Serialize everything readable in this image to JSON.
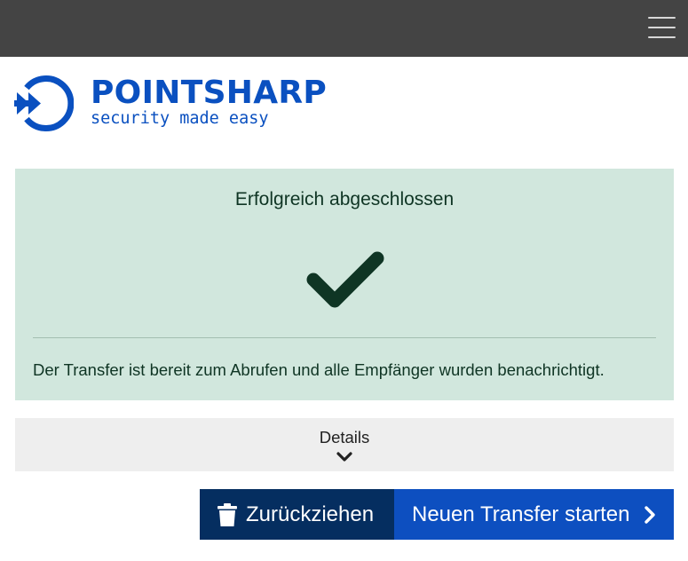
{
  "header": {
    "menu_icon": "hamburger-menu-icon"
  },
  "logo": {
    "name": "POINTSHARP",
    "tagline": "security made easy",
    "brand_color": "#0a50c0"
  },
  "alert": {
    "title": "Erfolgreich abgeschlossen",
    "icon": "checkmark-icon",
    "message": "Der Transfer ist bereit zum Abrufen und alle Empfänger wurden benachrichtigt.",
    "background_color": "#d1e7dd",
    "text_color": "#0f3524"
  },
  "details": {
    "label": "Details",
    "icon": "chevron-down-icon"
  },
  "actions": {
    "revoke_label": "Zurückziehen",
    "revoke_icon": "trash-icon",
    "revoke_color": "#052e60",
    "new_transfer_label": "Neuen Transfer starten",
    "new_transfer_icon": "chevron-right-icon",
    "new_transfer_color": "#0d4fc0"
  }
}
